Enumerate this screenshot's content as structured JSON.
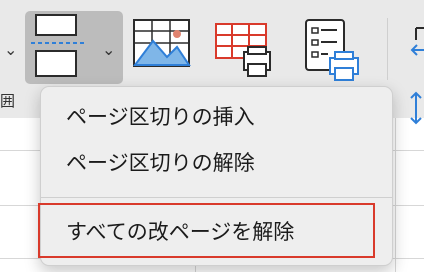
{
  "ribbon": {
    "left_partial_char": "囲",
    "pagebreak_button": {
      "icon": "page-break-icon",
      "chevron": "⌄"
    },
    "background_button": {
      "icon": "background-picture-icon"
    },
    "print_titles_button": {
      "icon": "print-titles-icon"
    },
    "print_area_button": {
      "icon": "print-area-icon"
    },
    "right_partial_buttons": [
      {
        "icon": "arrow-left-icon"
      },
      {
        "icon": "arrow-updown-icon"
      }
    ]
  },
  "menu": {
    "items": [
      {
        "label": "ページ区切りの挿入"
      },
      {
        "label": "ページ区切りの解除"
      },
      {
        "label": "すべての改ページを解除",
        "highlighted": true
      }
    ]
  },
  "colors": {
    "highlight_border": "#d93a2b",
    "accent_blue": "#2f7fd8",
    "accent_red": "#d93a2b"
  }
}
